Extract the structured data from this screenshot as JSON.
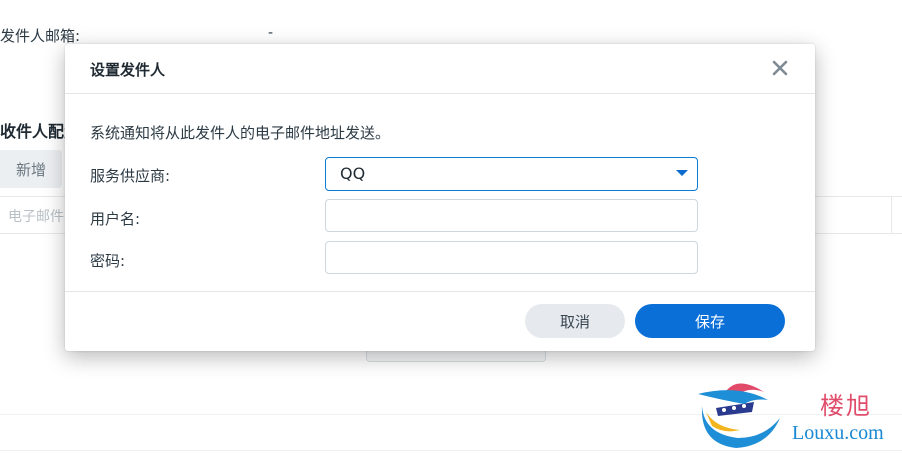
{
  "background": {
    "sender_email_label": "发件人邮箱:",
    "sender_email_value": "-",
    "recipient_section_heading": "收件人配置",
    "add_button_label": "新增",
    "table_column_email": "电子邮件"
  },
  "dialog": {
    "title": "设置发件人",
    "description": "系统通知将从此发件人的电子邮件地址发送。",
    "provider_label": "服务供应商:",
    "provider_value": "QQ",
    "username_label": "用户名:",
    "username_value": "",
    "password_label": "密码:",
    "password_value": "",
    "cancel_label": "取消",
    "save_label": "保存"
  },
  "watermark": {
    "cn": "楼旭",
    "en": "Louxu.com"
  },
  "colors": {
    "primary": "#0b6fd8",
    "select_border": "#0b7cd6",
    "cancel_bg": "#e6e9ed",
    "watermark_red": "#e04d6b",
    "watermark_blue": "#1788d4"
  }
}
